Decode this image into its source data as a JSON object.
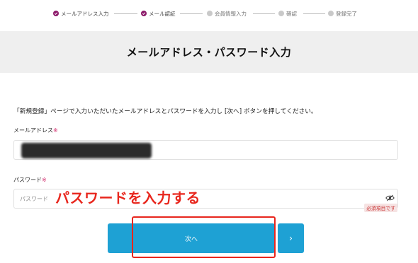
{
  "stepper": {
    "steps": [
      {
        "label": "メールアドレス入力",
        "status": "done"
      },
      {
        "label": "メール認証",
        "status": "done"
      },
      {
        "label": "会員情報入力",
        "status": "todo"
      },
      {
        "label": "確認",
        "status": "todo"
      },
      {
        "label": "登録完了",
        "status": "todo"
      }
    ]
  },
  "page": {
    "title": "メールアドレス・パスワード入力",
    "instruction": "「新規登録」ページで入力いただいたメールアドレスとパスワードを入力し [次へ] ボタンを押してください。"
  },
  "form": {
    "email_label": "メールアドレス",
    "password_label": "パスワード",
    "required_mark": "※",
    "password_placeholder": "パスワード",
    "required_tag": "必須項目です",
    "eye_icon": "eye-slash-icon"
  },
  "annotation": {
    "text": "パスワードを入力する",
    "color": "#e8261d"
  },
  "buttons": {
    "next_label": "次へ",
    "arrow_label": "›"
  },
  "colors": {
    "accent": "#1ea1d4",
    "step_done": "#8c1a6a",
    "required": "#d2296b"
  }
}
